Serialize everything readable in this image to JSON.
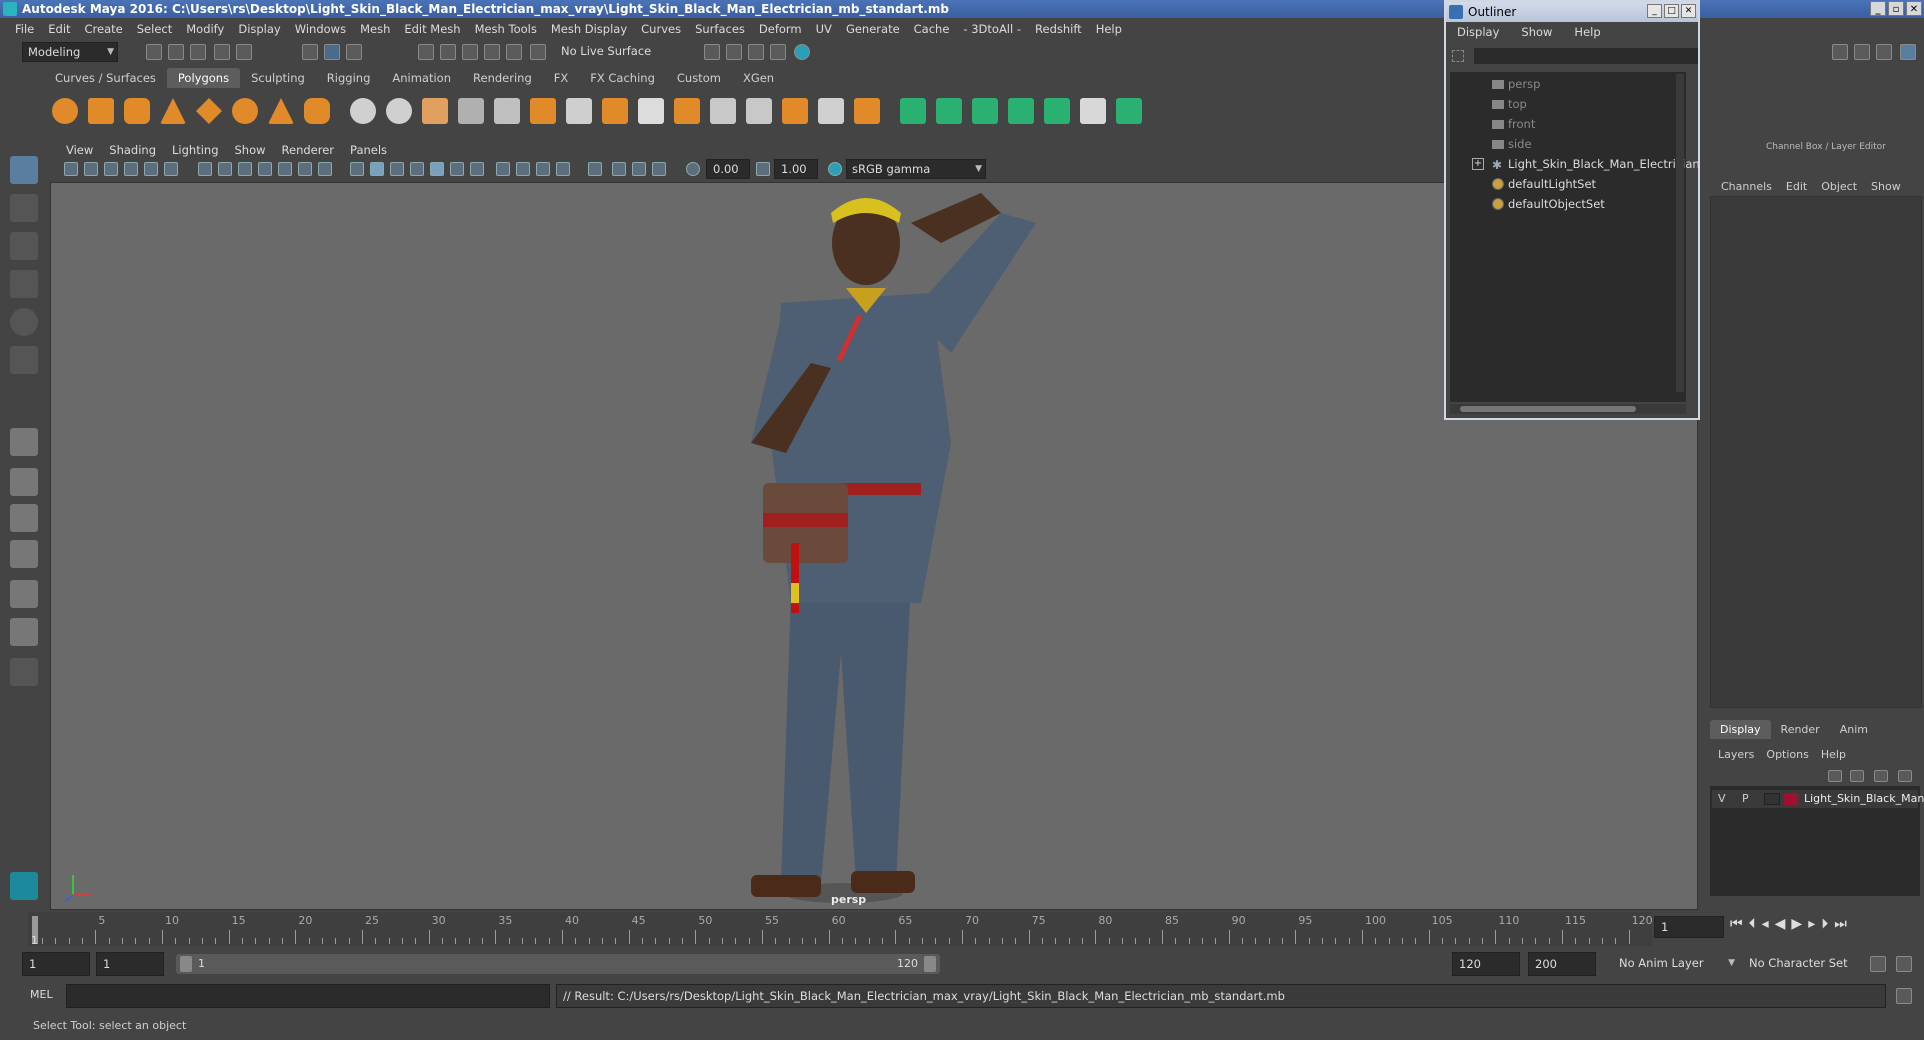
{
  "window": {
    "title": "Autodesk Maya 2016: C:\\Users\\rs\\Desktop\\Light_Skin_Black_Man_Electrician_max_vray\\Light_Skin_Black_Man_Electrician_mb_standart.mb"
  },
  "menubar": [
    "File",
    "Edit",
    "Create",
    "Select",
    "Modify",
    "Display",
    "Windows",
    "Mesh",
    "Edit Mesh",
    "Mesh Tools",
    "Mesh Display",
    "Curves",
    "Surfaces",
    "Deform",
    "UV",
    "Generate",
    "Cache",
    "- 3DtoAll -",
    "Redshift",
    "Help"
  ],
  "status": {
    "mode": "Modeling",
    "live_surface": "No Live Surface"
  },
  "shelf_tabs": [
    "Curves / Surfaces",
    "Polygons",
    "Sculpting",
    "Rigging",
    "Animation",
    "Rendering",
    "FX",
    "FX Caching",
    "Custom",
    "XGen"
  ],
  "shelf_active": "Polygons",
  "viewport": {
    "menu": [
      "View",
      "Shading",
      "Lighting",
      "Show",
      "Renderer",
      "Panels"
    ],
    "exposure": "0.00",
    "gamma": "1.00",
    "color_space": "sRGB gamma",
    "camera_label": "persp"
  },
  "outliner": {
    "title": "Outliner",
    "menu": [
      "Display",
      "Show",
      "Help"
    ],
    "items": [
      {
        "label": "persp",
        "dim": true
      },
      {
        "label": "top",
        "dim": true
      },
      {
        "label": "front",
        "dim": true
      },
      {
        "label": "side",
        "dim": true
      },
      {
        "label": "Light_Skin_Black_Man_Electrician",
        "dim": false
      },
      {
        "label": "defaultLightSet",
        "dim": false
      },
      {
        "label": "defaultObjectSet",
        "dim": false
      }
    ]
  },
  "channel_box": {
    "header": "Channel Box / Layer Editor",
    "menu": [
      "Channels",
      "Edit",
      "Object",
      "Show"
    ]
  },
  "layer_editor": {
    "tabs": [
      "Display",
      "Render",
      "Anim"
    ],
    "active_tab": "Display",
    "menu": [
      "Layers",
      "Options",
      "Help"
    ],
    "layer": {
      "v": "V",
      "p": "P",
      "name": "Light_Skin_Black_Man",
      "color": "#a01030"
    }
  },
  "timeline": {
    "ticks": [
      "5",
      "10",
      "15",
      "20",
      "25",
      "30",
      "35",
      "40",
      "45",
      "50",
      "55",
      "60",
      "65",
      "70",
      "75",
      "80",
      "85",
      "90",
      "95",
      "100",
      "105",
      "110",
      "115",
      "120"
    ],
    "start_marker": "1",
    "current_frame": "1"
  },
  "range": {
    "start": "1",
    "playback_start": "1",
    "slider_start": "1",
    "slider_end": "120",
    "playback_end": "120",
    "end": "200",
    "anim_layer": "No Anim Layer",
    "character_set": "No Character Set"
  },
  "command_line": {
    "type": "MEL",
    "result": "// Result: C:/Users/rs/Desktop/Light_Skin_Black_Man_Electrician_max_vray/Light_Skin_Black_Man_Electrician_mb_standart.mb"
  },
  "help_line": "Select Tool: select an object",
  "colors": {
    "title_bar": "#3a5fa0",
    "panel_bg": "#444444",
    "viewport_bg": "#6a6a6a",
    "field_bg": "#2b2b2b",
    "accent_layer": "#a01030"
  }
}
